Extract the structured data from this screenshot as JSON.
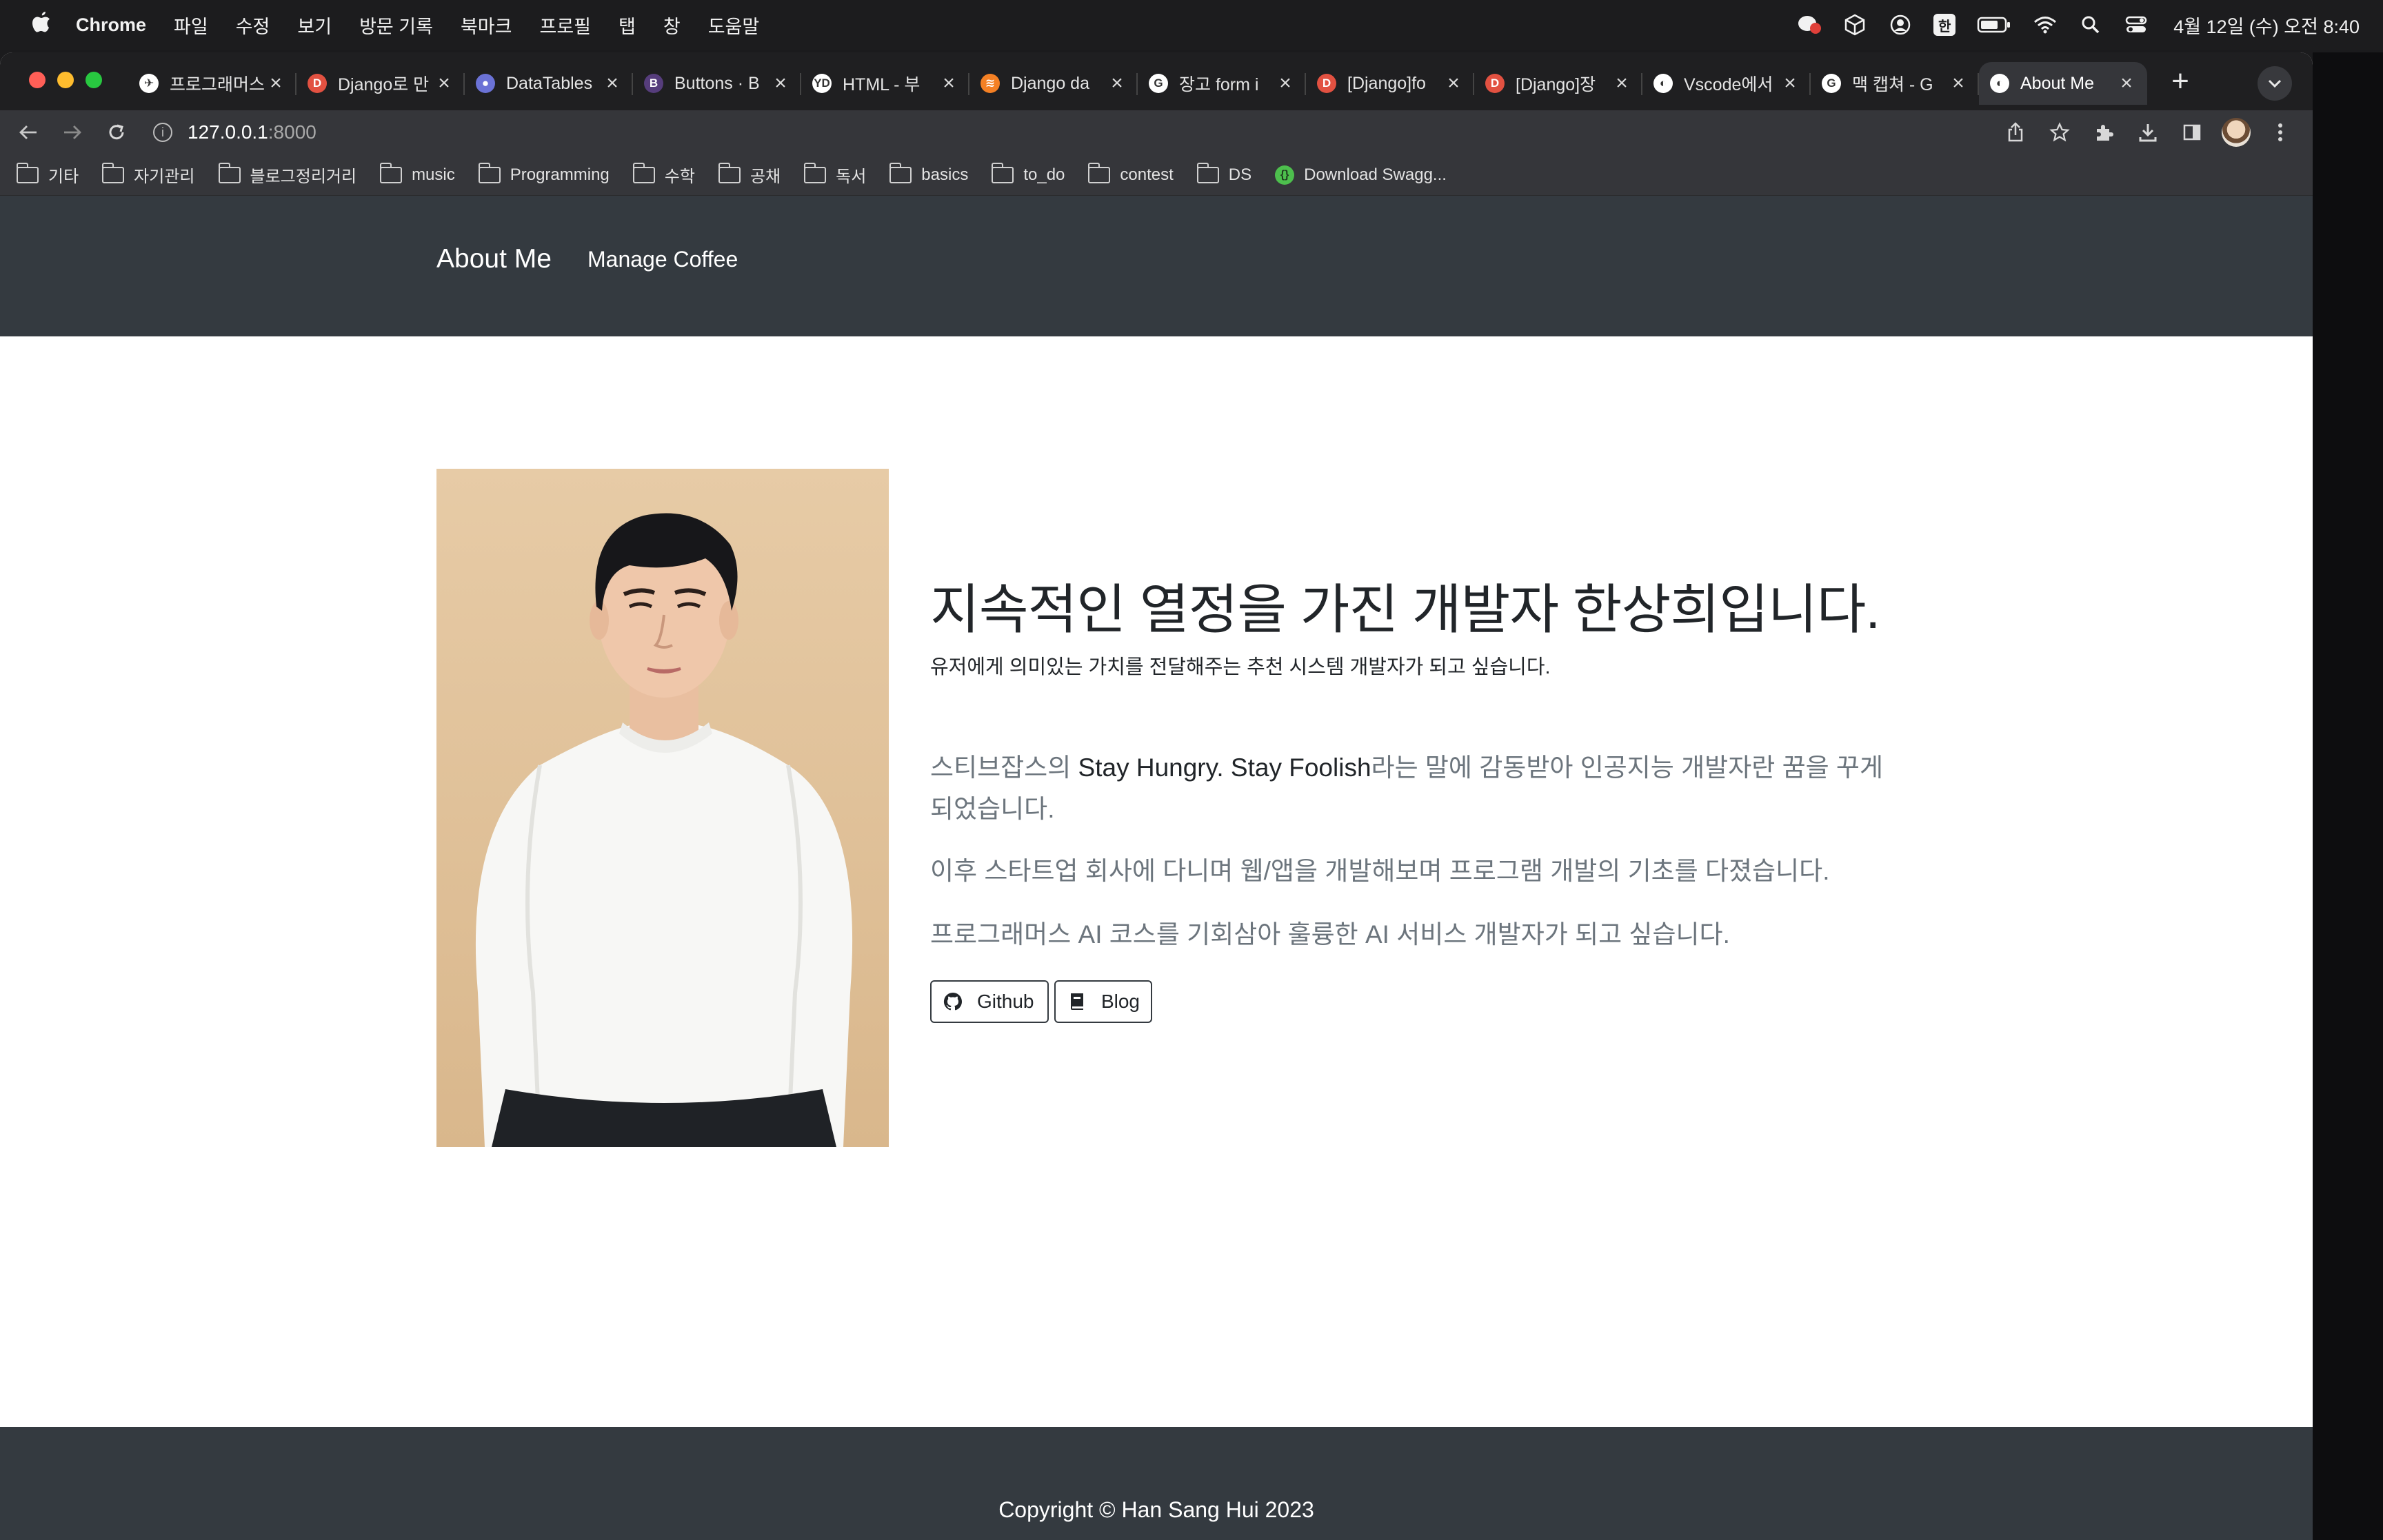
{
  "menubar": {
    "app_name": "Chrome",
    "menus": [
      "파일",
      "수정",
      "보기",
      "방문 기록",
      "북마크",
      "프로필",
      "탭",
      "창",
      "도움말"
    ],
    "input_method": "한",
    "clock": "4월 12일 (수) 오전 8:40"
  },
  "tabs": [
    {
      "title": "프로그래머스",
      "favicon_color": "#ffffff",
      "favicon_text": "✈"
    },
    {
      "title": "Django로 만",
      "favicon_color": "#e25141",
      "favicon_text": "D"
    },
    {
      "title": "DataTables",
      "favicon_color": "#6b72d6",
      "favicon_text": "●"
    },
    {
      "title": "Buttons · B",
      "favicon_color": "#563d7c",
      "favicon_text": "B"
    },
    {
      "title": "HTML - 부",
      "favicon_color": "#ffffff",
      "favicon_text": "YD"
    },
    {
      "title": "Django da",
      "favicon_color": "#f48024",
      "favicon_text": "≋"
    },
    {
      "title": "장고 form i",
      "favicon_color": "#ffffff",
      "favicon_text": "G"
    },
    {
      "title": "[Django]fo",
      "favicon_color": "#e25141",
      "favicon_text": "D"
    },
    {
      "title": "[Django]장",
      "favicon_color": "#e25141",
      "favicon_text": "D"
    },
    {
      "title": "Vscode에서",
      "favicon_color": "#ffffff",
      "favicon_text": "◐"
    },
    {
      "title": "맥 캡쳐 - G",
      "favicon_color": "#ffffff",
      "favicon_text": "G"
    },
    {
      "title": "About Me",
      "favicon_color": "#ffffff",
      "favicon_text": "◐",
      "active": true
    }
  ],
  "address": {
    "host": "127.0.0.1",
    "port": ":8000"
  },
  "bookmarks": [
    {
      "label": "기타",
      "type": "folder"
    },
    {
      "label": "자기관리",
      "type": "folder"
    },
    {
      "label": "블로그정리거리",
      "type": "folder"
    },
    {
      "label": "music",
      "type": "folder"
    },
    {
      "label": "Programming",
      "type": "folder"
    },
    {
      "label": "수학",
      "type": "folder"
    },
    {
      "label": "공채",
      "type": "folder"
    },
    {
      "label": "독서",
      "type": "folder"
    },
    {
      "label": "basics",
      "type": "folder"
    },
    {
      "label": "to_do",
      "type": "folder"
    },
    {
      "label": "contest",
      "type": "folder"
    },
    {
      "label": "DS",
      "type": "folder"
    },
    {
      "label": "Download Swagg...",
      "type": "link"
    }
  ],
  "site": {
    "brand": "About Me",
    "nav_link": "Manage Coffee",
    "hero_title": "지속적인 열정을 가진 개발자 한상희입니다.",
    "hero_subtitle": "유저에게 의미있는 가치를 전달해주는 추천 시스템 개발자가 되고 싶습니다.",
    "intro_1_pre": "스티브잡스의 ",
    "intro_1_accent": "Stay Hungry. Stay Foolish",
    "intro_1_post": "라는 말에 감동받아 인공지능 개발자란 꿈을 꾸게 되었습니다.",
    "intro_2": "이후 스타트업 회사에 다니며 웹/앱을 개발해보며 프로그램 개발의 기초를 다졌습니다.",
    "intro_3": "프로그래머스 AI 코스를 기회삼아 훌륭한 AI 서비스 개발자가 되고 싶습니다.",
    "github_label": "Github",
    "blog_label": "Blog",
    "copyright": "Copyright © Han Sang Hui 2023"
  },
  "colors": {
    "navbar_bg": "#343a40",
    "footer_bg": "#343a40",
    "text_dark": "#212529",
    "text_muted": "#6c757d"
  }
}
